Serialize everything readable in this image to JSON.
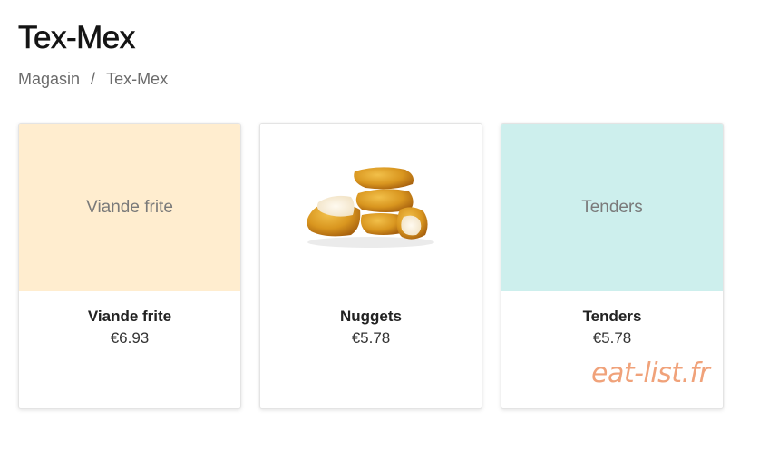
{
  "page": {
    "title": "Tex-Mex"
  },
  "breadcrumb": {
    "items": [
      "Magasin",
      "Tex-Mex"
    ],
    "separator": "/"
  },
  "products": [
    {
      "name": "Viande frite",
      "price": "€6.93",
      "placeholder": "Viande frite",
      "bg": "#ffedcf",
      "image": "none"
    },
    {
      "name": "Nuggets",
      "price": "€5.78",
      "placeholder": "",
      "bg": "#ffffff",
      "image": "chicken-nuggets-photo"
    },
    {
      "name": "Tenders",
      "price": "€5.78",
      "placeholder": "Tenders",
      "bg": "#cdefed",
      "image": "none"
    }
  ],
  "watermark": "eat-list.fr"
}
